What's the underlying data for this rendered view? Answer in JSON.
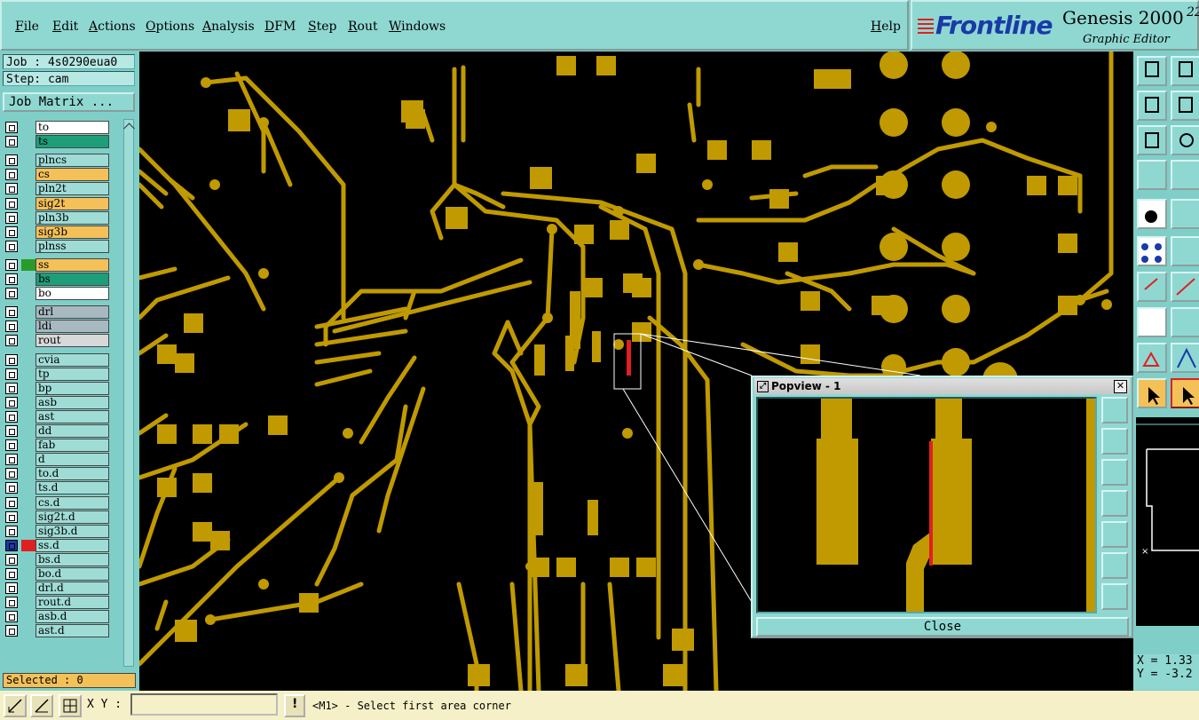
{
  "menu": {
    "items": [
      "File",
      "Edit",
      "Actions",
      "Options",
      "Analysis",
      "DFM",
      "Step",
      "Rout",
      "Windows"
    ],
    "help": "Help"
  },
  "brand": {
    "logo": "Frontline",
    "product": "Genesis 2000",
    "subtitle": "Graphic Editor",
    "version_frag": "22"
  },
  "left": {
    "job": "Job : 4s0290eua0",
    "step": "Step: cam",
    "job_matrix": "Job Matrix ...",
    "selected": "Selected : 0"
  },
  "layers": [
    {
      "name": "to",
      "bg": "#ffffff",
      "swatch": ""
    },
    {
      "name": "ts",
      "bg": "#1e9e78",
      "swatch": ""
    },
    {
      "name": "plncs",
      "bg": "#9fdcd6",
      "swatch": ""
    },
    {
      "name": "cs",
      "bg": "#f4c058",
      "swatch": ""
    },
    {
      "name": "pln2t",
      "bg": "#9fdcd6",
      "swatch": ""
    },
    {
      "name": "sig2t",
      "bg": "#f4c058",
      "swatch": ""
    },
    {
      "name": "pln3b",
      "bg": "#9fdcd6",
      "swatch": ""
    },
    {
      "name": "sig3b",
      "bg": "#f4c058",
      "swatch": ""
    },
    {
      "name": "plnss",
      "bg": "#9fdcd6",
      "swatch": ""
    },
    {
      "name": "ss",
      "bg": "#f4c058",
      "swatch": "#2a9a2a"
    },
    {
      "name": "bs",
      "bg": "#1e9e78",
      "swatch": ""
    },
    {
      "name": "bo",
      "bg": "#ffffff",
      "swatch": ""
    },
    {
      "name": "drl",
      "bg": "#a8b8c0",
      "swatch": ""
    },
    {
      "name": "ldi",
      "bg": "#a8b8c0",
      "swatch": ""
    },
    {
      "name": "rout",
      "bg": "#d8d8d8",
      "swatch": ""
    },
    {
      "name": "cvia",
      "bg": "#9fdcd6",
      "swatch": ""
    },
    {
      "name": "tp",
      "bg": "#9fdcd6",
      "swatch": ""
    },
    {
      "name": "bp",
      "bg": "#9fdcd6",
      "swatch": ""
    },
    {
      "name": "asb",
      "bg": "#9fdcd6",
      "swatch": ""
    },
    {
      "name": "ast",
      "bg": "#9fdcd6",
      "swatch": ""
    },
    {
      "name": "dd",
      "bg": "#9fdcd6",
      "swatch": ""
    },
    {
      "name": "fab",
      "bg": "#9fdcd6",
      "swatch": ""
    },
    {
      "name": "d",
      "bg": "#9fdcd6",
      "swatch": ""
    },
    {
      "name": "to.d",
      "bg": "#9fdcd6",
      "swatch": ""
    },
    {
      "name": "ts.d",
      "bg": "#9fdcd6",
      "swatch": ""
    },
    {
      "name": "cs.d",
      "bg": "#9fdcd6",
      "swatch": ""
    },
    {
      "name": "sig2t.d",
      "bg": "#9fdcd6",
      "swatch": ""
    },
    {
      "name": "sig3b.d",
      "bg": "#9fdcd6",
      "swatch": ""
    },
    {
      "name": "ss.d",
      "bg": "#9fdcd6",
      "swatch": "#e02020"
    },
    {
      "name": "bs.d",
      "bg": "#9fdcd6",
      "swatch": ""
    },
    {
      "name": "bo.d",
      "bg": "#9fdcd6",
      "swatch": ""
    },
    {
      "name": "drl.d",
      "bg": "#9fdcd6",
      "swatch": ""
    },
    {
      "name": "rout.d",
      "bg": "#9fdcd6",
      "swatch": ""
    },
    {
      "name": "asb.d",
      "bg": "#9fdcd6",
      "swatch": ""
    },
    {
      "name": "ast.d",
      "bg": "#9fdcd6",
      "swatch": ""
    }
  ],
  "popview": {
    "title": "Popview - 1",
    "close": "Close"
  },
  "coords": {
    "x": "X = 1.33",
    "y": "Y = -3.2"
  },
  "bottom": {
    "xy_label": "X Y :",
    "input_value": "",
    "status": "<M1> - Select first area corner"
  },
  "colors": {
    "copper": "#c09a00",
    "background": "#000000",
    "panel": "#7fcfc8",
    "highlight": "#e02020"
  }
}
